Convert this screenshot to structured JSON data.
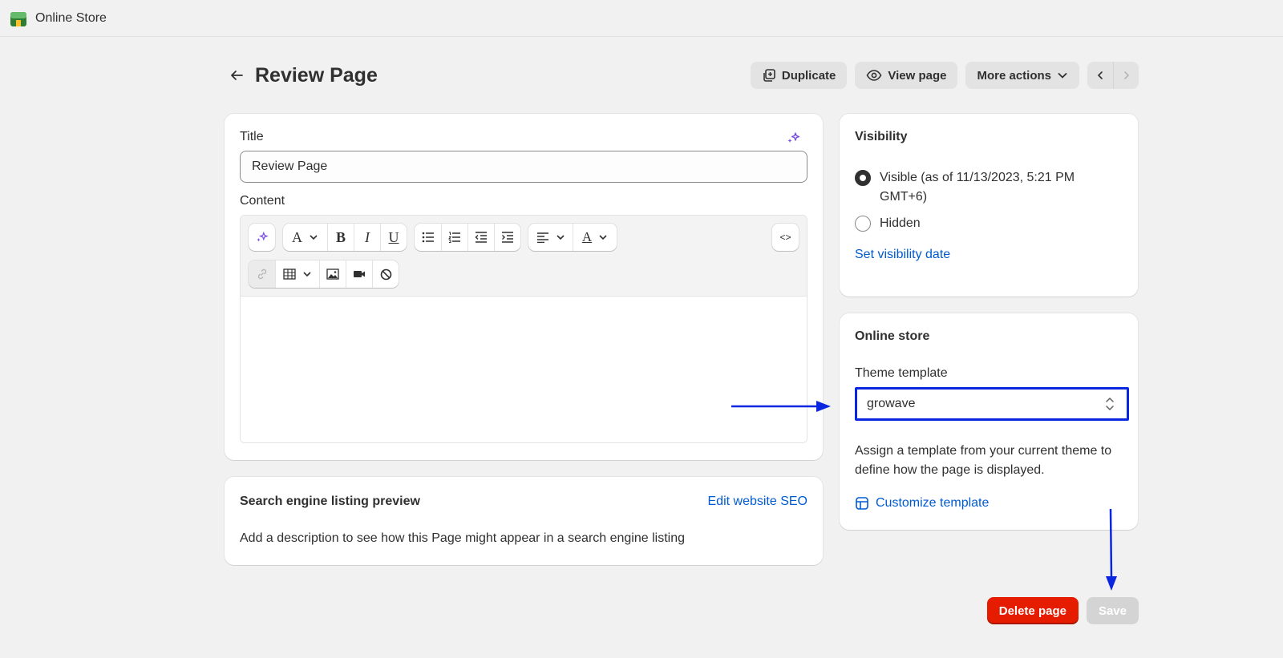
{
  "app": {
    "title": "Online Store"
  },
  "header": {
    "title": "Review Page",
    "duplicate_label": "Duplicate",
    "view_label": "View page",
    "more_label": "More actions"
  },
  "main": {
    "title_label": "Title",
    "title_value": "Review Page",
    "content_label": "Content",
    "code_label": "<>"
  },
  "seo": {
    "heading": "Search engine listing preview",
    "edit_link": "Edit website SEO",
    "description": "Add a description to see how this Page might appear in a search engine listing"
  },
  "visibility": {
    "heading": "Visibility",
    "options": [
      {
        "label": "Visible (as of 11/13/2023, 5:21 PM GMT+6)",
        "selected": true
      },
      {
        "label": "Hidden",
        "selected": false
      }
    ],
    "set_date_link": "Set visibility date"
  },
  "online_store": {
    "heading": "Online store",
    "template_label": "Theme template",
    "template_value": "growave",
    "help_text": "Assign a template from your current theme to define how the page is displayed.",
    "customize_link": "Customize template"
  },
  "footer": {
    "delete_label": "Delete page",
    "save_label": "Save"
  },
  "colors": {
    "accent_link": "#005bd3",
    "danger": "#e51c00",
    "annotation_arrow": "#0b26e0"
  }
}
